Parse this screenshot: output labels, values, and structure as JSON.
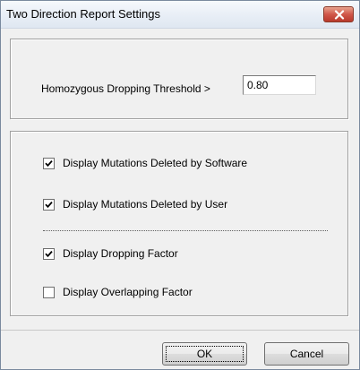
{
  "window": {
    "title": "Two Direction Report Settings"
  },
  "threshold": {
    "label": "Homozygous Dropping Threshold >",
    "value": "0.80"
  },
  "options": [
    {
      "label": "Display Mutations Deleted by Software",
      "checked": true
    },
    {
      "label": "Display Mutations Deleted by User",
      "checked": true
    },
    {
      "label": "Display Dropping Factor",
      "checked": true
    },
    {
      "label": "Display Overlapping Factor",
      "checked": false
    }
  ],
  "buttons": {
    "ok_label": "OK",
    "cancel_label": "Cancel"
  },
  "colors": {
    "close_button": "#c9483b",
    "dialog_background": "#f0f0f0"
  },
  "icons": {
    "close": "close-icon",
    "check": "checkmark-icon"
  }
}
